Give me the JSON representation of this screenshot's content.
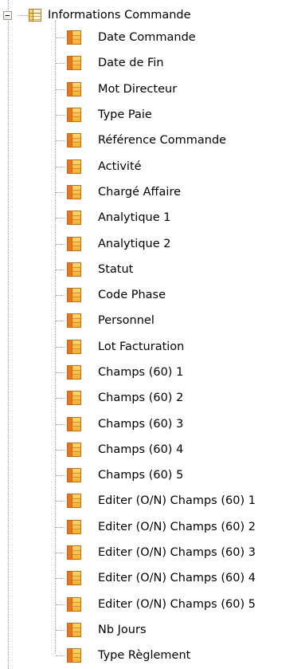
{
  "tree": {
    "root": {
      "label": "Informations Commande",
      "expander": "minus-expander-icon",
      "icon": "table-icon"
    },
    "items": [
      {
        "label": "Date Commande",
        "icon": "field-icon"
      },
      {
        "label": "Date de Fin",
        "icon": "field-icon"
      },
      {
        "label": "Mot Directeur",
        "icon": "field-icon"
      },
      {
        "label": "Type Paie",
        "icon": "field-icon"
      },
      {
        "label": "Référence Commande",
        "icon": "field-icon"
      },
      {
        "label": "Activité",
        "icon": "field-icon"
      },
      {
        "label": "Chargé Affaire",
        "icon": "field-icon"
      },
      {
        "label": "Analytique 1",
        "icon": "field-icon"
      },
      {
        "label": "Analytique 2",
        "icon": "field-icon"
      },
      {
        "label": "Statut",
        "icon": "field-icon"
      },
      {
        "label": "Code Phase",
        "icon": "field-icon"
      },
      {
        "label": "Personnel",
        "icon": "field-icon"
      },
      {
        "label": "Lot Facturation",
        "icon": "field-icon"
      },
      {
        "label": "Champs (60) 1",
        "icon": "field-icon"
      },
      {
        "label": "Champs (60) 2",
        "icon": "field-icon"
      },
      {
        "label": "Champs (60) 3",
        "icon": "field-icon"
      },
      {
        "label": "Champs (60) 4",
        "icon": "field-icon"
      },
      {
        "label": "Champs (60) 5",
        "icon": "field-icon"
      },
      {
        "label": "Editer (O/N) Champs (60) 1",
        "icon": "field-icon"
      },
      {
        "label": "Editer (O/N) Champs (60) 2",
        "icon": "field-icon"
      },
      {
        "label": "Editer (O/N) Champs (60) 3",
        "icon": "field-icon"
      },
      {
        "label": "Editer (O/N) Champs (60) 4",
        "icon": "field-icon"
      },
      {
        "label": "Editer (O/N) Champs (60) 5",
        "icon": "field-icon"
      },
      {
        "label": "Nb Jours",
        "icon": "field-icon"
      },
      {
        "label": "Type Règlement",
        "icon": "field-icon"
      }
    ]
  }
}
